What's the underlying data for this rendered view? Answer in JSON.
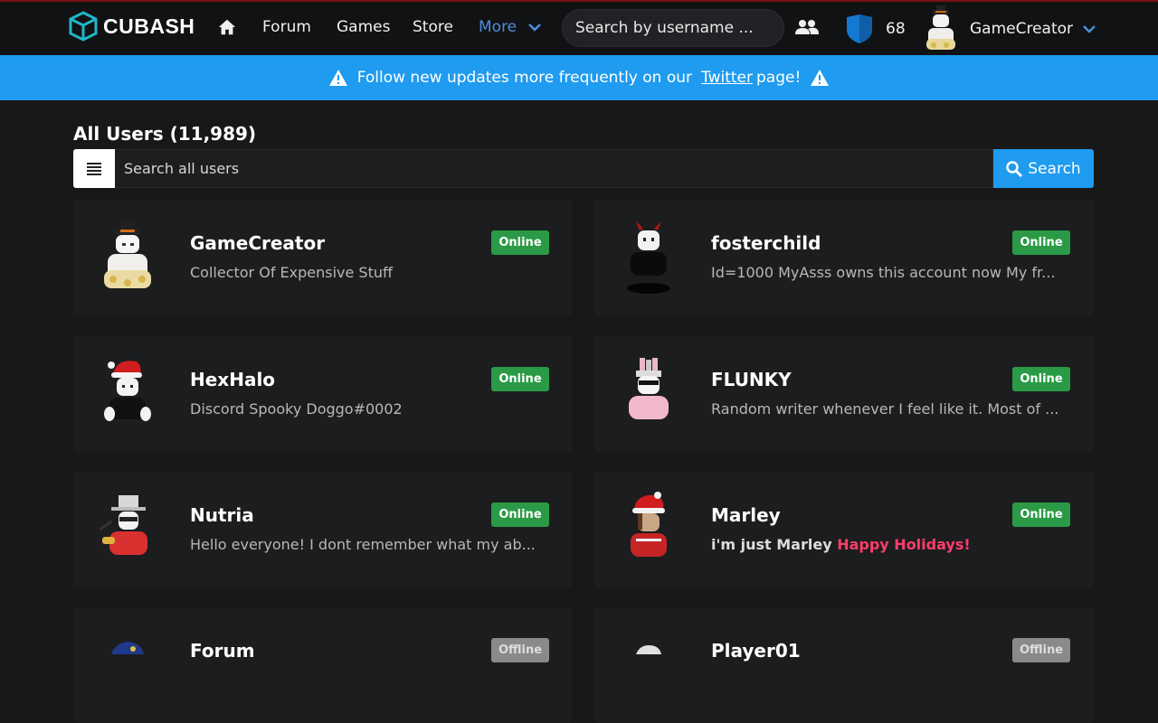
{
  "app": {
    "brand": "CUBASH"
  },
  "nav": {
    "links": [
      "Forum",
      "Games",
      "Store"
    ],
    "more_label": "More",
    "search_placeholder": "Search by username ...",
    "currency_value": "68",
    "username": "GameCreator"
  },
  "banner": {
    "text_before": "Follow new updates more frequently on our",
    "link": "Twitter",
    "text_after": "page!"
  },
  "page": {
    "heading": "All Users (11,989)",
    "search_placeholder": "Search all users",
    "search_button": "Search"
  },
  "users": [
    {
      "name": "GameCreator",
      "bio": "Collector Of Expensive Stuff",
      "status": "Online"
    },
    {
      "name": "fosterchild",
      "bio": "Id=1000 MyAsss owns this account now My fr...",
      "status": "Online"
    },
    {
      "name": "HexHalo",
      "bio": "Discord Spooky Doggo#0002",
      "status": "Online"
    },
    {
      "name": "FLUNKY",
      "bio": "Random writer whenever I feel like it. Most of ...",
      "status": "Online"
    },
    {
      "name": "Nutria",
      "bio": "Hello everyone! I dont remember what my ab...",
      "status": "Online"
    },
    {
      "name": "Marley",
      "bio": "i'm just Marley",
      "bio_highlight": "Happy Holidays!",
      "status": "Online"
    },
    {
      "name": "Forum",
      "bio": "",
      "status": "Offline"
    },
    {
      "name": "Player01",
      "bio": "",
      "status": "Offline"
    }
  ],
  "colors": {
    "accent": "#1f9bef",
    "online": "#2a9a46",
    "offline": "#8a8a8a",
    "holiday": "#ff3d6b"
  }
}
